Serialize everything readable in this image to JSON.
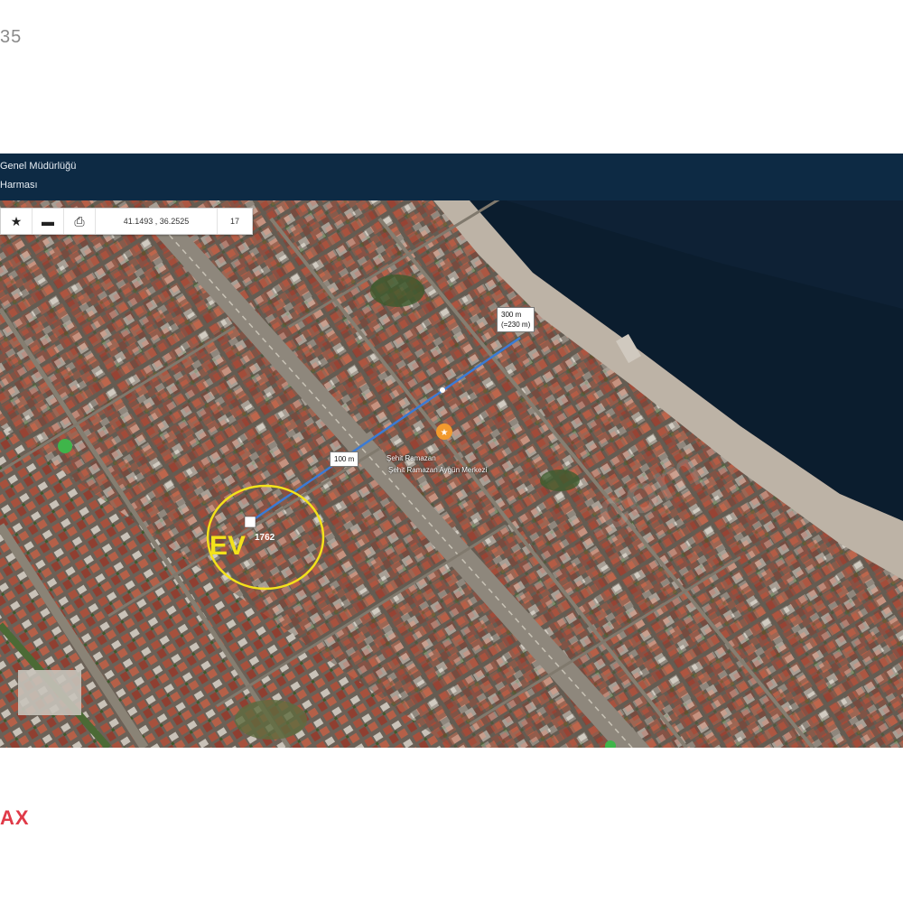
{
  "page": {
    "corner_text": "35",
    "brand_text": "AX"
  },
  "header": {
    "line1": "Genel Müdürlüğü",
    "line2": "Harması"
  },
  "toolbar": {
    "star_icon": "star-icon",
    "measure_icon": "ruler-icon",
    "print_icon": "print-icon",
    "coordinates": "41.1493 , 36.2525",
    "zoom": "17"
  },
  "map": {
    "distance_label_1": "300 m",
    "distance_label_1b": "(=230 m)",
    "distance_label_2": "100 m",
    "ev_label": "EV",
    "ev_number": "1762",
    "poi_label_1": "Şehit Ramazan",
    "poi_label_2": "Şehit Ramazan Aygün Merkezi",
    "colors": {
      "sea": "#0b1d2e",
      "beach": "#bdb3a6",
      "road": "#9c958a",
      "line": "#3a7bd5",
      "circle": "#f3e21b",
      "header": "#0d2a44"
    }
  }
}
